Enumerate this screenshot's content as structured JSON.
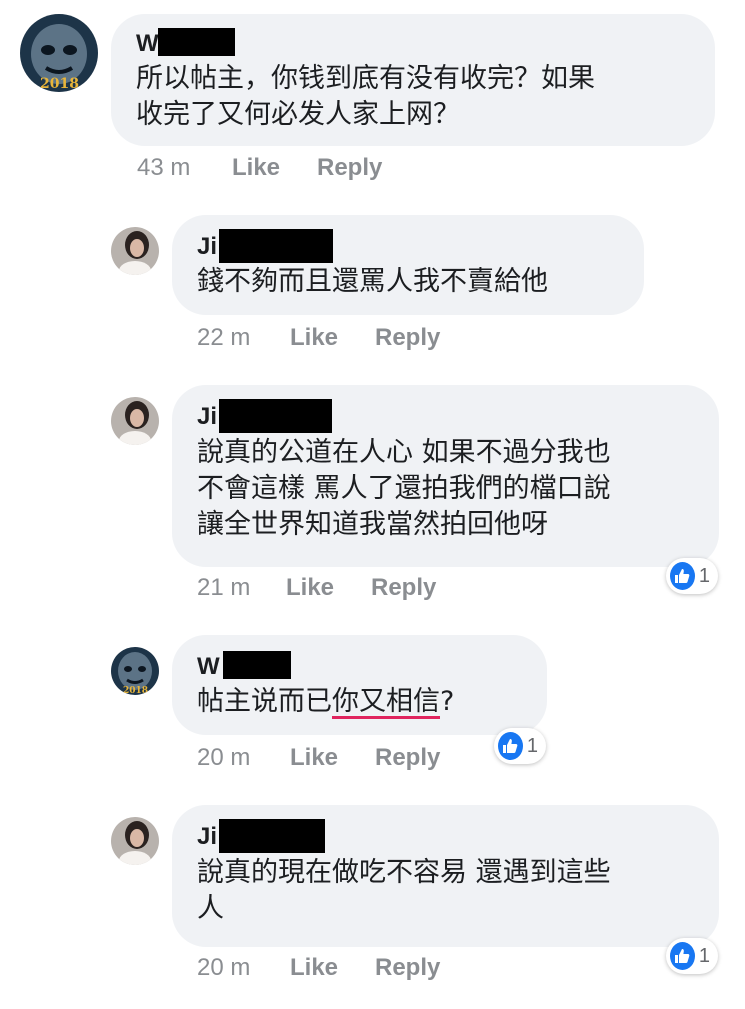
{
  "colors": {
    "bubble_bg": "#f0f2f5",
    "meta_text": "#8a8d91",
    "like_blue": "#1877f2",
    "spellcheck_underline": "#e0245e"
  },
  "comments": [
    {
      "author_visible": "W",
      "text": "所以帖主，你钱到底有没有收完？如果\n收完了又何必发人家上网？",
      "time": "43 m",
      "like": "Like",
      "reply": "Reply",
      "avatar": "demon-mask-2018-avatar"
    },
    {
      "author_visible": "Ji",
      "text": "錢不夠而且還罵人我不賣給他",
      "time": "22 m",
      "like": "Like",
      "reply": "Reply",
      "avatar": "woman-photo-avatar"
    },
    {
      "author_visible": "Ji",
      "text": "說真的公道在人心 如果不過分我也\n不會這樣 罵人了還拍我們的檔口說\n讓全世界知道我當然拍回他呀",
      "time": "21 m",
      "like": "Like",
      "reply": "Reply",
      "reaction_count": "1",
      "avatar": "woman-photo-avatar"
    },
    {
      "author_visible": "W",
      "text_before": "帖主说而已",
      "text_underlined": "你又相信",
      "text_after": "?",
      "time": "20 m",
      "like": "Like",
      "reply": "Reply",
      "reaction_count": "1",
      "avatar": "demon-mask-2018-avatar"
    },
    {
      "author_visible": "Ji",
      "text": "說真的現在做吃不容易 還遇到這些\n人",
      "time": "20 m",
      "like": "Like",
      "reply": "Reply",
      "reaction_count": "1",
      "avatar": "woman-photo-avatar"
    }
  ]
}
